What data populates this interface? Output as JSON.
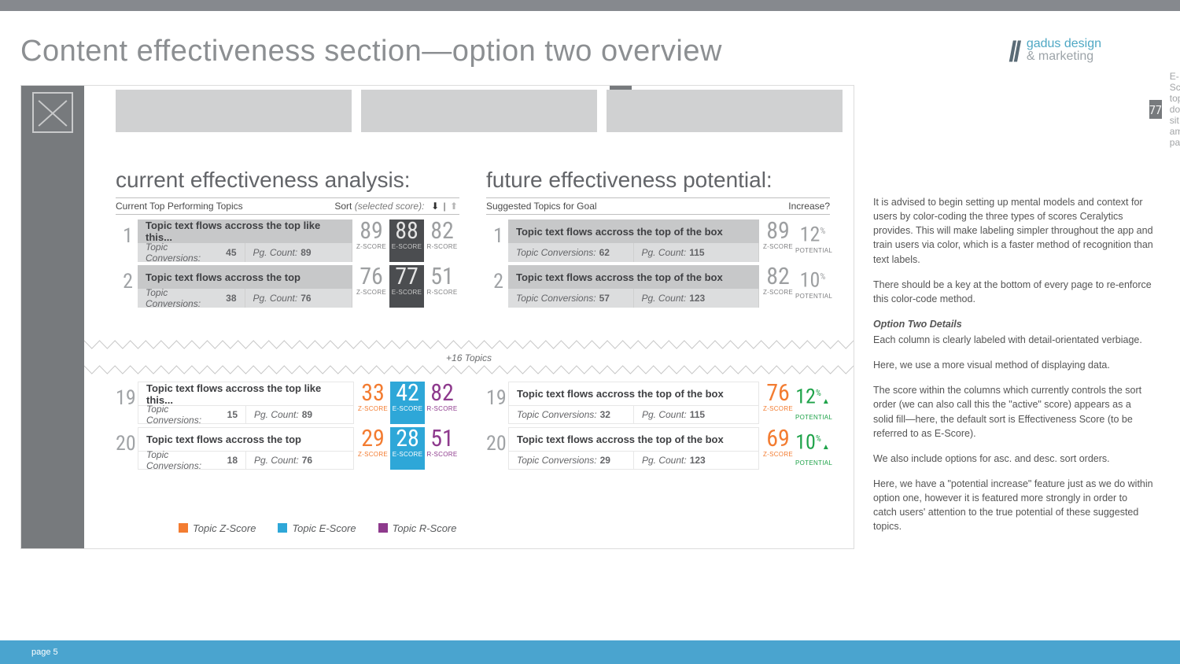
{
  "title": "Content effectiveness section—option two overview",
  "logo": {
    "line1": "gadus design",
    "line2": "& marketing"
  },
  "pill": {
    "value": "77",
    "label": "E-Score topic: dolor sit ament parque"
  },
  "colLeft": {
    "heading": "current effectiveness analysis:",
    "subLeft": "Current Top Performing Topics",
    "sortLabel": "Sort",
    "sortNote": "(selected score):",
    "scoreCaps": [
      "Z-SCORE",
      "E-SCORE",
      "R-SCORE"
    ],
    "rows": [
      {
        "rank": "1",
        "title": "Topic text flows accross the top like this...",
        "conv": "45",
        "pg": "89",
        "scores": [
          "89",
          "88",
          "82"
        ]
      },
      {
        "rank": "2",
        "title": "Topic text flows accross the top",
        "conv": "38",
        "pg": "76",
        "scores": [
          "76",
          "77",
          "51"
        ]
      },
      {
        "rank": "19",
        "title": "Topic text flows accross the top like this...",
        "conv": "15",
        "pg": "89",
        "scores": [
          "33",
          "42",
          "82"
        ]
      },
      {
        "rank": "20",
        "title": "Topic text flows accross the top",
        "conv": "18",
        "pg": "76",
        "scores": [
          "29",
          "28",
          "51"
        ]
      }
    ]
  },
  "colRight": {
    "heading": "future effectiveness potential:",
    "subLeft": "Suggested Topics for Goal",
    "subRight": "Increase?",
    "scoreCaps": [
      "Z-SCORE",
      "POTENTIAL"
    ],
    "rows": [
      {
        "rank": "1",
        "title": "Topic text flows accross the top of the box",
        "conv": "62",
        "pg": "115",
        "z": "89",
        "pct": "12"
      },
      {
        "rank": "2",
        "title": "Topic text flows accross the top of the box",
        "conv": "57",
        "pg": "123",
        "z": "82",
        "pct": "10"
      },
      {
        "rank": "19",
        "title": "Topic text flows accross the top of the box",
        "conv": "32",
        "pg": "115",
        "z": "76",
        "pct": "12"
      },
      {
        "rank": "20",
        "title": "Topic text flows accross the top of the box",
        "conv": "29",
        "pg": "123",
        "z": "69",
        "pct": "10"
      }
    ]
  },
  "labels": {
    "conv": "Topic Conversions:",
    "pg": "Pg. Count:"
  },
  "more": "+16 Topics",
  "legend": {
    "z": "Topic Z-Score",
    "e": "Topic E-Score",
    "r": "Topic R-Score"
  },
  "side": {
    "p1": "It is advised to begin setting up mental models and context for users by color-coding the three types of scores Ceralytics provides. This will make labeling simpler throughout the app and train users via color, which is a faster method of recognition than text labels.",
    "p2": "There should be a key at the bottom of every page to re-enforce this color-code method.",
    "h": "Option Two Details",
    "p3": "Each column is clearly labeled with detail-orientated verbiage.",
    "p4": "Here, we use a more visual method of displaying data.",
    "p5": "The score within the columns which currently controls the sort order (we can also call this the \"active\" score) appears as a solid fill—here, the default sort is Effectiveness Score (to be referred to as E-Score).",
    "p6": "We also include options for asc. and desc. sort orders.",
    "p7": "Here, we have a \"potential increase\" feature just as we do within option one, however it is featured more strongly in order to catch users' attention to the true potential of these suggested topics."
  },
  "footer": "page 5"
}
